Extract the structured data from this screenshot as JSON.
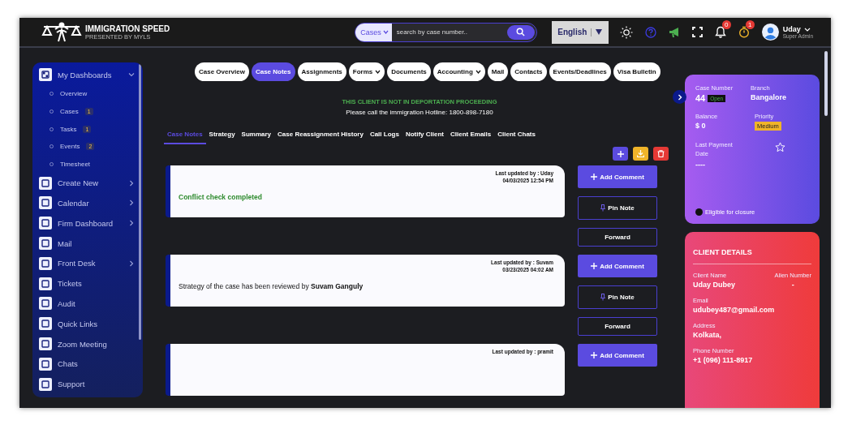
{
  "header": {
    "brand": "IMMIGRATION SPEED",
    "tagline": "PRESENTED BY MYLS",
    "search_scope": "Cases",
    "search_placeholder": "search by case number..",
    "language": "English",
    "bell_badge": "0",
    "timer_badge": "1",
    "user_name": "Uday",
    "user_role": "Super Admin"
  },
  "sidebar": {
    "items": [
      {
        "label": "My Dashboards",
        "expanded": true,
        "children": [
          {
            "label": "Overview"
          },
          {
            "label": "Cases",
            "count": "1"
          },
          {
            "label": "Tasks",
            "count": "1"
          },
          {
            "label": "Events",
            "count": "2"
          },
          {
            "label": "Timesheet"
          }
        ]
      },
      {
        "label": "Create New",
        "expanded": false
      },
      {
        "label": "Calendar",
        "expanded": false
      },
      {
        "label": "Firm Dashboard",
        "expanded": false
      },
      {
        "label": "Mail"
      },
      {
        "label": "Front Desk",
        "expanded": false
      },
      {
        "label": "Tickets"
      },
      {
        "label": "Audit"
      },
      {
        "label": "Quick Links"
      },
      {
        "label": "Zoom Meeting"
      },
      {
        "label": "Chats"
      },
      {
        "label": "Support"
      }
    ]
  },
  "tabs": [
    {
      "label": "Case Overview",
      "selected": false,
      "dropdown": false
    },
    {
      "label": "Case Notes",
      "selected": true,
      "dropdown": false
    },
    {
      "label": "Assignments",
      "selected": false,
      "dropdown": false
    },
    {
      "label": "Forms",
      "selected": false,
      "dropdown": true
    },
    {
      "label": "Documents",
      "selected": false,
      "dropdown": false
    },
    {
      "label": "Accounting",
      "selected": false,
      "dropdown": true
    },
    {
      "label": "Mail",
      "selected": false,
      "dropdown": false
    },
    {
      "label": "Contacts",
      "selected": false,
      "dropdown": false
    },
    {
      "label": "Events/Deadlines",
      "selected": false,
      "dropdown": false
    },
    {
      "label": "Visa Bulletin",
      "selected": false,
      "dropdown": false
    }
  ],
  "notice": {
    "status": "THIS CLIENT IS NOT IN DEPORTATION PROCEEDING",
    "hotline": "Please call the immigration Hotline: 1800-898-7180"
  },
  "subtabs": [
    {
      "label": "Case Notes",
      "selected": true
    },
    {
      "label": "Strategy",
      "selected": false
    },
    {
      "label": "Summary",
      "selected": false
    },
    {
      "label": "Case Reassignment History",
      "selected": false
    },
    {
      "label": "Call Logs",
      "selected": false
    },
    {
      "label": "Notify Client",
      "selected": false
    },
    {
      "label": "Client Emails",
      "selected": false
    },
    {
      "label": "Client Chats",
      "selected": false
    }
  ],
  "notes": [
    {
      "updated_by": "Last updated by : Uday",
      "date": "04/03/2025 12:54 PM",
      "kind": "status",
      "text": "Conflict check completed",
      "actions": [
        "Add Comment",
        "Pin Note",
        "Forward"
      ]
    },
    {
      "updated_by": "Last updated by : Suvam",
      "date": "03/23/2025 04:02 AM",
      "kind": "plain",
      "text": "Strategy of the case has been reviewed by **Suvam Ganguly**",
      "actions": [
        "Add Comment",
        "Pin Note",
        "Forward"
      ]
    },
    {
      "updated_by": "Last updated by : pramit",
      "actions": [
        "Add Comment"
      ]
    }
  ],
  "case_card": {
    "case_number_label": "Case Number",
    "case_number": "44",
    "status": "Open",
    "branch_label": "Branch",
    "branch": "Bangalore",
    "balance_label": "Balance",
    "balance": "$ 0",
    "priority_label": "Priority",
    "priority": "Medium",
    "payment_label": "Last Payment Date",
    "payment_date": "----",
    "starred": false,
    "eligible_for_closure": false,
    "eligible_label": "Eligible for closure"
  },
  "client_details": {
    "title": "CLIENT DETAILS",
    "fields": [
      {
        "label": "Client Name",
        "value": "Uday Dubey",
        "label_2": "Alien Number",
        "value_2": "-"
      },
      {
        "label": "Email",
        "value": "udubey487@gmail.com"
      },
      {
        "label": "Address",
        "value": "Kolkata,"
      },
      {
        "label": "Phone Number",
        "value": "+1 (096) 111-8917"
      }
    ]
  }
}
